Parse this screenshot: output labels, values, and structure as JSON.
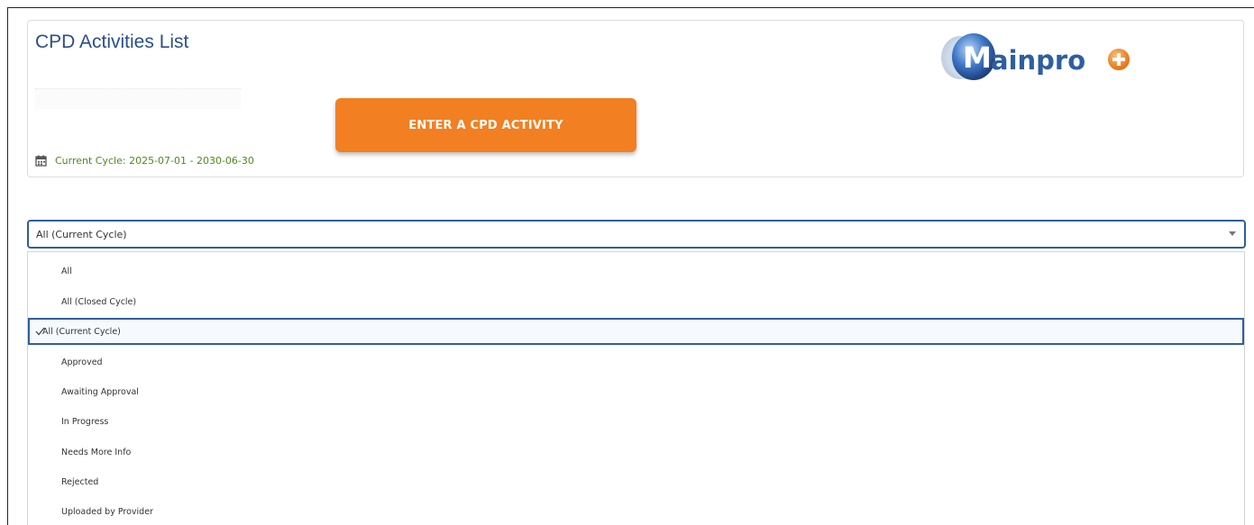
{
  "header": {
    "title": "CPD Activities List",
    "cta_label": "ENTER A CPD ACTIVITY",
    "cycle_text": "Current Cycle: 2025-07-01 - 2030-06-30",
    "logo": {
      "text_main": "ainpro",
      "text_initial": "M",
      "icon": "plus-circle-icon",
      "brand_color": "#2d5ea3",
      "accent_color": "#f27f22"
    }
  },
  "filter": {
    "selected": "All (Current Cycle)",
    "options": [
      {
        "label": "All"
      },
      {
        "label": "All (Closed Cycle)"
      },
      {
        "label": "All (Current Cycle)",
        "selected": true
      },
      {
        "label": "Approved"
      },
      {
        "label": "Awaiting Approval"
      },
      {
        "label": "In Progress"
      },
      {
        "label": "Needs More Info"
      },
      {
        "label": "Rejected"
      },
      {
        "label": "Uploaded by Provider"
      }
    ]
  },
  "colors": {
    "cta": "#f27f22",
    "cycle_text": "#4f8a1c",
    "title": "#2b4f8a",
    "focus_border": "#2d5ea3"
  }
}
